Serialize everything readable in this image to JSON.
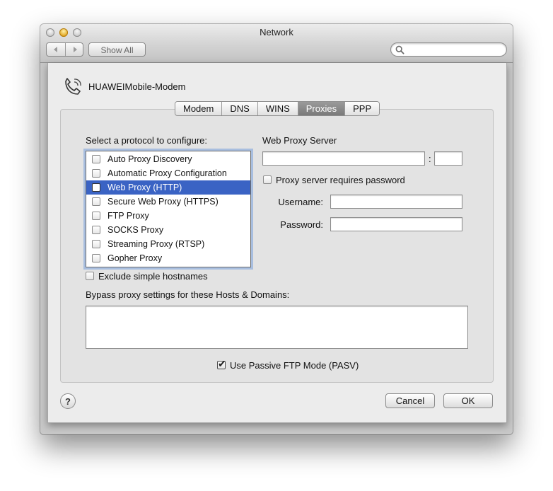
{
  "window": {
    "title": "Network",
    "show_all_label": "Show All",
    "search_placeholder": ""
  },
  "sheet": {
    "service_name": "HUAWEIMobile-Modem",
    "tabs": [
      "Modem",
      "DNS",
      "WINS",
      "Proxies",
      "PPP"
    ],
    "active_tab": "Proxies",
    "protocol_heading": "Select a protocol to configure:",
    "protocols": [
      {
        "label": "Auto Proxy Discovery",
        "checked": false,
        "selected": false
      },
      {
        "label": "Automatic Proxy Configuration",
        "checked": false,
        "selected": false
      },
      {
        "label": "Web Proxy (HTTP)",
        "checked": false,
        "selected": true
      },
      {
        "label": "Secure Web Proxy (HTTPS)",
        "checked": false,
        "selected": false
      },
      {
        "label": "FTP Proxy",
        "checked": false,
        "selected": false
      },
      {
        "label": "SOCKS Proxy",
        "checked": false,
        "selected": false
      },
      {
        "label": "Streaming Proxy (RTSP)",
        "checked": false,
        "selected": false
      },
      {
        "label": "Gopher Proxy",
        "checked": false,
        "selected": false
      }
    ],
    "proxy_server_heading": "Web Proxy Server",
    "proxy_server_value": "",
    "port_separator": ":",
    "port_value": "",
    "requires_password_label": "Proxy server requires password",
    "requires_password_checked": false,
    "username_label": "Username:",
    "username_value": "",
    "password_label": "Password:",
    "password_value": "",
    "exclude_simple_label": "Exclude simple hostnames",
    "exclude_simple_checked": false,
    "bypass_label": "Bypass proxy settings for these Hosts & Domains:",
    "bypass_value": "",
    "passive_ftp_label": "Use Passive FTP Mode (PASV)",
    "passive_ftp_checked": true,
    "help_label": "?",
    "cancel_label": "Cancel",
    "ok_label": "OK",
    "checkmark": "✔"
  },
  "colors": {
    "selection": "#3a63c4",
    "focus_ring": "#78a0dc"
  },
  "icons": {
    "service": "phone-icon",
    "search": "magnifier-icon",
    "back": "back-arrow-icon",
    "forward": "forward-arrow-icon"
  }
}
